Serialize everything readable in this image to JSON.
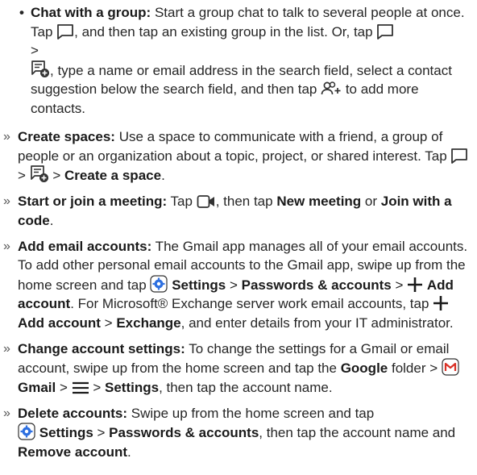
{
  "group_chat": {
    "title": "Chat with a group:",
    "t1": " Start a group chat to talk to several people at once. Tap ",
    "t2": ", and then tap an existing group in the list. Or, tap ",
    "t3": " >",
    "t4": ", type a name or email address in the search field, select a contact suggestion below the search field, and then tap ",
    "t5": " to add more contacts."
  },
  "items": [
    {
      "title": "Create spaces:",
      "t1": " Use a space to communicate with a friend, a group of people or an organization about a topic, project, or shared interest. Tap ",
      "sep1": " > ",
      "sep2": " > ",
      "b1": "Create a space",
      "t2": "."
    },
    {
      "title": "Start or join a meeting:",
      "t1": " Tap ",
      "t2": ", then tap ",
      "b1": "New meeting",
      "t3": " or ",
      "b2": "Join with a code",
      "t4": "."
    },
    {
      "title": "Add email accounts:",
      "t1": " The Gmail app manages all of your email accounts. To add other personal email accounts to the Gmail app, swipe up from the home screen and tap ",
      "b1": "Settings",
      "t2": " > ",
      "b2": "Passwords & accounts",
      "t3": " > ",
      "b3": "Add account",
      "t4": ". For Microsoft® Exchange server work email accounts, tap ",
      "b4": "Add account",
      "t5": " > ",
      "b5": "Exchange",
      "t6": ", and enter details from your IT administrator."
    },
    {
      "title": "Change account settings:",
      "t1": " To change the settings for a Gmail or email account, swipe up from the home screen and tap the ",
      "b1": "Google",
      "t2": " folder > ",
      "b2": "Gmail",
      "t3": " > ",
      "t4": " > ",
      "b3": "Settings",
      "t5": ", then tap the account name."
    },
    {
      "title": "Delete accounts:",
      "t1": " Swipe up from the home screen and tap ",
      "b1": "Settings",
      "t2": " > ",
      "b2": "Passwords & accounts",
      "t3": ", then tap the account name and ",
      "b3": "Remove account",
      "t4": "."
    }
  ],
  "bullets": {
    "sub": "•",
    "main": "»"
  },
  "icons": [
    "chat-bubble-icon",
    "new-chat-icon",
    "add-people-icon",
    "video-camera-icon",
    "settings-gear-icon",
    "plus-icon",
    "gmail-icon",
    "menu-icon"
  ],
  "colors": {
    "text": "#262626",
    "gear_blue": "#2d6fe0",
    "gmail_red": "#d93025"
  }
}
